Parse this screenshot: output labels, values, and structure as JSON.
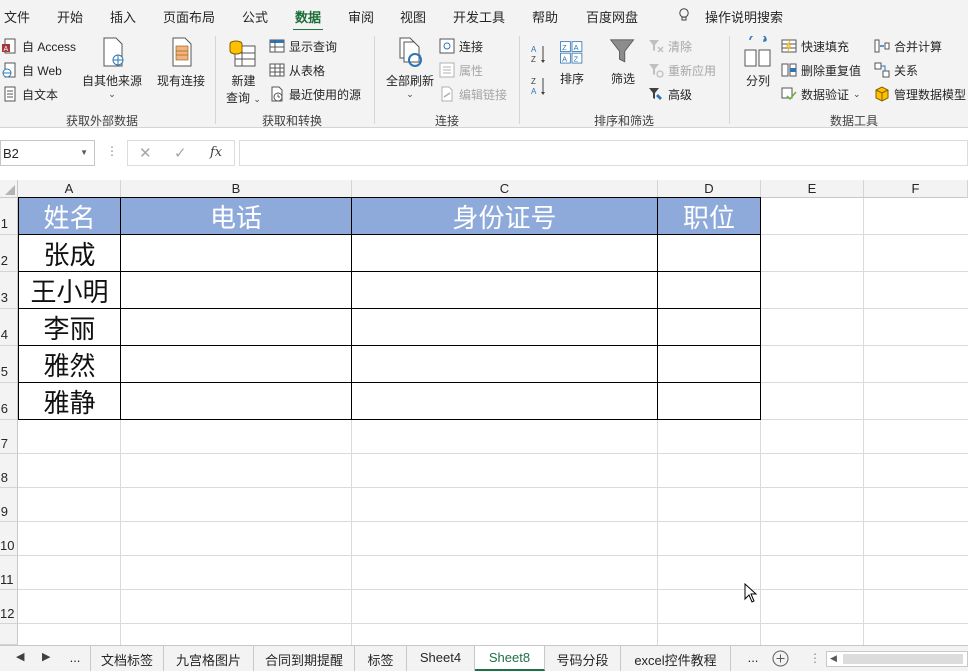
{
  "ribbon_tabs": [
    "文件",
    "开始",
    "插入",
    "页面布局",
    "公式",
    "数据",
    "审阅",
    "视图",
    "开发工具",
    "帮助",
    "百度网盘",
    "操作说明搜索"
  ],
  "active_tab": "数据",
  "groups": {
    "external": {
      "label": "获取外部数据",
      "access": "自 Access",
      "web": "自 Web",
      "text": "自文本",
      "other_sources": "自其他来源",
      "existing": "现有连接"
    },
    "transform": {
      "label": "获取和转换",
      "new_query_line1": "新建",
      "new_query_line2": "查询",
      "show_queries": "显示查询",
      "from_table": "从表格",
      "recent_sources": "最近使用的源"
    },
    "connections": {
      "label": "连接",
      "refresh_all": "全部刷新",
      "connections": "连接",
      "properties": "属性",
      "edit_links": "编辑链接"
    },
    "sort_filter": {
      "label": "排序和筛选",
      "sort": "排序",
      "filter": "筛选",
      "clear": "清除",
      "reapply": "重新应用",
      "advanced": "高级"
    },
    "data_tools": {
      "label": "数据工具",
      "split": "分列",
      "flash_fill": "快速填充",
      "remove_duplicates": "删除重复值",
      "validation": "数据验证",
      "consolidate": "合并计算",
      "relationships": "关系",
      "manage_model": "管理数据模型"
    }
  },
  "formula_bar": {
    "name_box": "B2",
    "fx": "fx",
    "cancel": "✕",
    "enter": "✓",
    "formula": ""
  },
  "columns": [
    "A",
    "B",
    "C",
    "D",
    "E",
    "F"
  ],
  "rows": [
    "1",
    "2",
    "3",
    "4",
    "5",
    "6",
    "7",
    "8",
    "9",
    "10",
    "11",
    "12"
  ],
  "table": {
    "headers": [
      "姓名",
      "电话",
      "身份证号",
      "职位"
    ],
    "names": [
      "张成",
      "王小明",
      "李丽",
      "雅然",
      "雅静"
    ]
  },
  "sheet_tabs": [
    "...",
    "文档标签",
    "九宫格图片",
    "合同到期提醒",
    "标签",
    "Sheet4",
    "Sheet8",
    "号码分段",
    "excel控件教程",
    "..."
  ],
  "active_sheet": "Sheet8",
  "colors": {
    "accent": "#1e7145",
    "header_fill": "#8eaadb",
    "header_text": "#ffffff"
  }
}
